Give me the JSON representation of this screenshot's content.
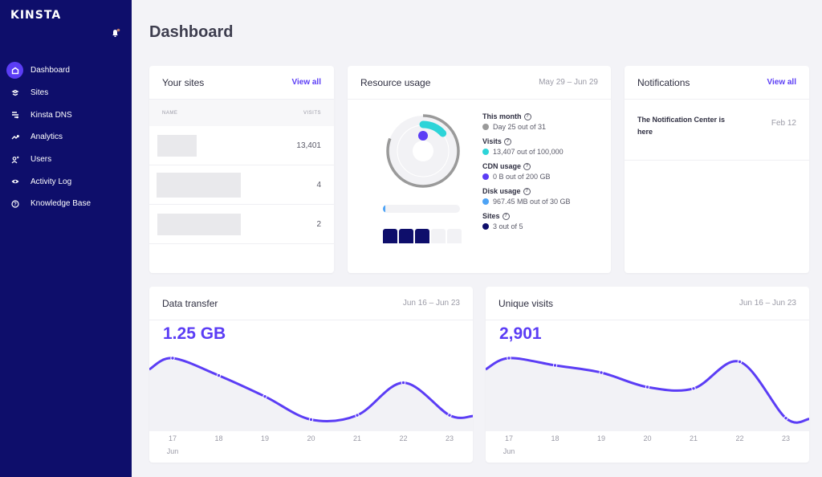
{
  "sidebar": {
    "logo": "KINSTA",
    "items": [
      {
        "label": "Dashboard",
        "icon": "home-icon",
        "active": true
      },
      {
        "label": "Sites",
        "icon": "layers-icon"
      },
      {
        "label": "Kinsta DNS",
        "icon": "dns-icon"
      },
      {
        "label": "Analytics",
        "icon": "trend-icon"
      },
      {
        "label": "Users",
        "icon": "add-user-icon"
      },
      {
        "label": "Activity Log",
        "icon": "eye-icon"
      },
      {
        "label": "Knowledge Base",
        "icon": "help-icon"
      }
    ]
  },
  "page": {
    "title": "Dashboard"
  },
  "sites": {
    "title": "Your sites",
    "view_all": "View all",
    "col_name": "NAME",
    "col_visits": "VISITS",
    "rows": [
      {
        "visits": "13,401"
      },
      {
        "visits": "4"
      },
      {
        "visits": "2"
      }
    ]
  },
  "resources": {
    "title": "Resource usage",
    "range": "May 29 – Jun 29",
    "items": [
      {
        "title": "This month",
        "value": "Day 25 out of 31",
        "color": "#9a9a9a",
        "fraction": 0.806
      },
      {
        "title": "Visits",
        "value": "13,407 out of 100,000",
        "color": "#2dd4d8",
        "fraction": 0.134
      },
      {
        "title": "CDN usage",
        "value": "0 B out of 200 GB",
        "color": "#5b3df5",
        "fraction": 0
      },
      {
        "title": "Disk usage",
        "value": "967.45 MB out of 30 GB",
        "color": "#4da3f5",
        "fraction": 0.032
      },
      {
        "title": "Sites",
        "value": "3 out of 5",
        "color": "#0e0e6b",
        "fraction": 0.6
      }
    ]
  },
  "notifications": {
    "title": "Notifications",
    "view_all": "View all",
    "items": [
      {
        "text": "The Notification Center is here",
        "date": "Feb 12"
      }
    ]
  },
  "chart_data": [
    {
      "type": "area",
      "title": "Data transfer",
      "range": "Jun 16 – Jun 23",
      "total": "1.25 GB",
      "categories": [
        "17",
        "18",
        "19",
        "20",
        "21",
        "22",
        "23"
      ],
      "month_label": "Jun",
      "values": [
        0.9,
        0.66,
        0.37,
        0.05,
        0.11,
        0.56,
        0.11
      ],
      "ylim": [
        0,
        1
      ]
    },
    {
      "type": "area",
      "title": "Unique visits",
      "range": "Jun 16 – Jun 23",
      "total": "2,901",
      "categories": [
        "17",
        "18",
        "19",
        "20",
        "21",
        "22",
        "23"
      ],
      "month_label": "Jun",
      "values": [
        0.9,
        0.8,
        0.7,
        0.5,
        0.48,
        0.85,
        0.07
      ],
      "ylim": [
        0,
        1
      ]
    }
  ]
}
